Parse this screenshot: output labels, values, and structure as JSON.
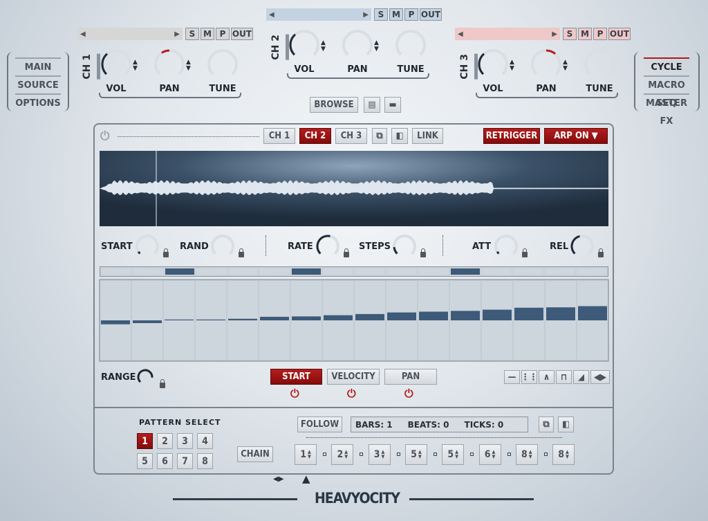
{
  "left_nav": {
    "items": [
      "MAIN",
      "SOURCE",
      "OPTIONS"
    ]
  },
  "right_nav": {
    "items": [
      "CYCLE",
      "MACRO SEQ",
      "MASTER FX"
    ],
    "active": "CYCLE"
  },
  "channels": [
    {
      "label": "CH 1",
      "color": "#d6d6d6",
      "buttons": [
        "S",
        "M",
        "P",
        "OUT"
      ],
      "knobs": [
        {
          "label": "VOL",
          "value": 0.35
        },
        {
          "label": "PAN",
          "value": -0.25
        },
        {
          "label": "TUNE",
          "value": 0
        }
      ]
    },
    {
      "label": "CH 2",
      "color": "#c4d3e2",
      "buttons": [
        "S",
        "M",
        "P",
        "OUT"
      ],
      "knobs": [
        {
          "label": "VOL",
          "value": 0.35
        },
        {
          "label": "PAN",
          "value": 0
        },
        {
          "label": "TUNE",
          "value": 0
        }
      ]
    },
    {
      "label": "CH 3",
      "color": "#efc8c8",
      "buttons": [
        "S",
        "M",
        "P",
        "OUT"
      ],
      "knobs": [
        {
          "label": "VOL",
          "value": 0.35
        },
        {
          "label": "PAN",
          "value": 0.3
        },
        {
          "label": "TUNE",
          "value": 0
        }
      ]
    }
  ],
  "browse": {
    "label": "BROWSE"
  },
  "toolbar": {
    "ch_tabs": [
      "CH 1",
      "CH 2",
      "CH 3"
    ],
    "active_tab": "CH 2",
    "link": "LINK",
    "retrigger": "RETRIGGER",
    "arp": "ARP ON ▼"
  },
  "params": [
    {
      "label": "START",
      "value": 0.05
    },
    {
      "label": "RAND",
      "value": 0
    },
    {
      "label": "RATE",
      "value": 0.55
    },
    {
      "label": "STEPS",
      "value": 0.15
    },
    {
      "label": "ATT",
      "value": 0.05
    },
    {
      "label": "REL",
      "value": 0.45
    }
  ],
  "sequencer": {
    "steps": 16,
    "active_steps": [
      3,
      7,
      12
    ],
    "values": [
      -0.1,
      -0.07,
      0,
      0,
      0.04,
      0.09,
      0.1,
      0.13,
      0.16,
      0.2,
      0.22,
      0.24,
      0.27,
      0.32,
      0.33,
      0.36
    ]
  },
  "range": {
    "label": "RANGE",
    "value": 0.85
  },
  "modes": {
    "items": [
      "START",
      "VELOCITY",
      "PAN"
    ],
    "active": "START"
  },
  "shapes": [
    "flat-icon",
    "random-icon",
    "triangle-icon",
    "square-icon",
    "ramp-icon",
    "shift-icon"
  ],
  "pattern": {
    "title": "PATTERN SELECT",
    "items": [
      "1",
      "2",
      "3",
      "4",
      "5",
      "6",
      "7",
      "8"
    ],
    "active": "1"
  },
  "chain": {
    "label": "CHAIN",
    "follow": "FOLLOW",
    "bars": "BARS: 1",
    "beats": "BEATS: 0",
    "ticks": "TICKS: 0",
    "slots": [
      "1",
      "2",
      "3",
      "5",
      "5",
      "6",
      "8",
      "8"
    ]
  },
  "brand": "HEAVYOCITY",
  "colors": {
    "accent": "#9e1414",
    "step": "#3d5a78"
  }
}
